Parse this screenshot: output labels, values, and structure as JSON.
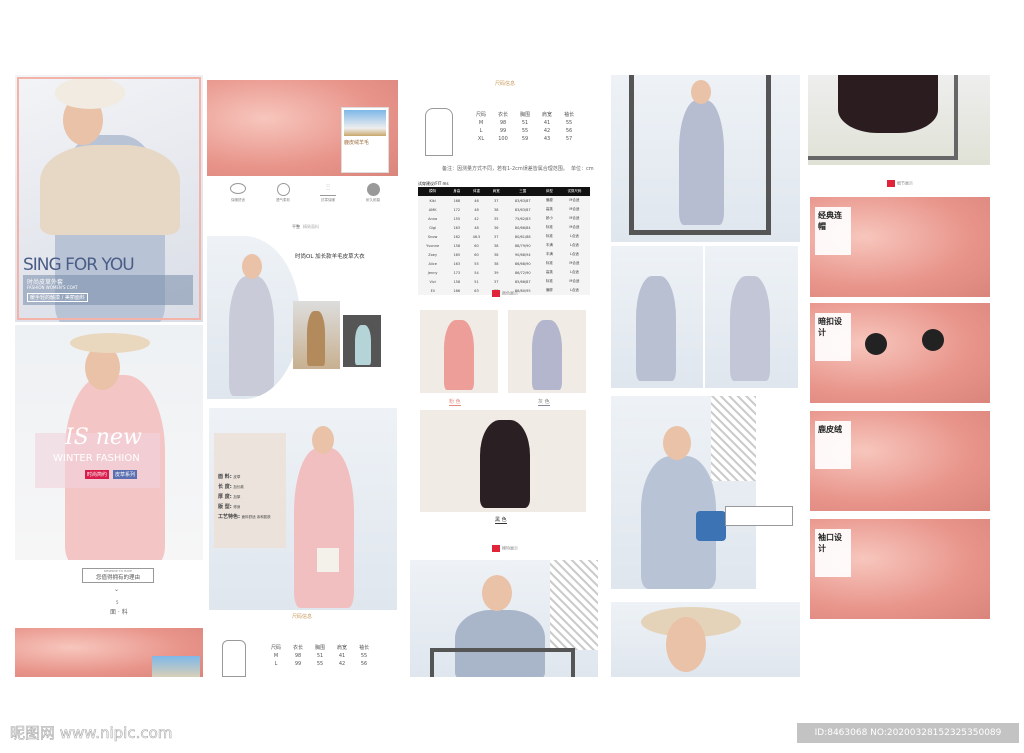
{
  "col1": {
    "banner_title": "SING FOR YOU",
    "banner_cn": "时尚皮草外套",
    "banner_en": "FASHION WOMEN'S COAT",
    "banner_sub": "暖手轻的触摸 / 美丽面料",
    "is_new": "IS new",
    "winter": "WINTER FASHION",
    "badge1": "时尚简约",
    "badge2": "皮草系列",
    "deserve_en": "DESERVE TO HAVE",
    "deserve_cn": "您值得拥有的理由",
    "section_no": "5",
    "section_title": "面 · 料"
  },
  "col2": {
    "fabric_title": "鹿皮绒羊毛",
    "features": [
      "保暖舒适",
      "透气柔软",
      "抗寒保暖",
      "耐久耐磨"
    ],
    "tabs": [
      "平整",
      "精致面料"
    ],
    "intro_title": "时尚OL 加长款羊毛皮草大衣",
    "details": [
      {
        "k": "面 料:",
        "v": "皮草"
      },
      {
        "k": "长 度:",
        "v": "加长款"
      },
      {
        "k": "厚 度:",
        "v": "加厚"
      },
      {
        "k": "版 型:",
        "v": "修身"
      },
      {
        "k": "工艺特色:",
        "v": "面料舒适 亲和肌肤"
      }
    ],
    "size_header": "尺码信息"
  },
  "sizes": {
    "headers": [
      "尺码",
      "衣长",
      "胸围",
      "肩宽",
      "袖长"
    ],
    "rows": [
      [
        "M",
        "98",
        "51",
        "41",
        "55"
      ],
      [
        "L",
        "99",
        "55",
        "42",
        "56"
      ],
      [
        "XL",
        "100",
        "59",
        "43",
        "57"
      ]
    ],
    "note": "备注：因测量方式不同，若有1-2cm误差皆属合理范围。",
    "unit": "单位：cm",
    "title": "尺码信息"
  },
  "tryon": {
    "title": "试穿建议/FIT ms",
    "headers": [
      "模特",
      "身高",
      "体重",
      "肩宽",
      "三围",
      "体型",
      "试穿尺码"
    ],
    "rows": [
      [
        "Kiki",
        "168",
        "46",
        "37",
        "83/63/87",
        "偏瘦",
        "M合适"
      ],
      [
        "AMK",
        "172",
        "48",
        "38",
        "83/63/87",
        "高挑",
        "M合适"
      ],
      [
        "Anna",
        "155",
        "42",
        "35",
        "75/62/83",
        "娇小",
        "M合适"
      ],
      [
        "Gigi",
        "163",
        "48",
        "36",
        "80/66/84",
        "标准",
        "M合适"
      ],
      [
        "Snow",
        "162",
        "46.5",
        "37",
        "80/61/88",
        "标准",
        "L合适"
      ],
      [
        "Yvonne",
        "158",
        "60",
        "38",
        "88/79/90",
        "丰满",
        "L合适"
      ],
      [
        "Zoey",
        "165",
        "60",
        "38",
        "90/68/94",
        "丰满",
        "L合适"
      ],
      [
        "Alice",
        "163",
        "55",
        "38",
        "86/68/90",
        "标准",
        "M合适"
      ],
      [
        "Jenny",
        "173",
        "54",
        "39",
        "86/72/90",
        "高挑",
        "L合适"
      ],
      [
        "Vivi",
        "158",
        "51",
        "37",
        "85/66/87",
        "标准",
        "M合适"
      ],
      [
        "Eli",
        "166",
        "63",
        "38",
        "86/80/95",
        "偏胖",
        "L合适"
      ]
    ]
  },
  "colors": {
    "header": "颜色展示",
    "pink": "粉 色",
    "grey": "灰 色",
    "black": "黑 色",
    "model_header": "模特展示"
  },
  "col5": {
    "header": "细节展示",
    "details": [
      "经典连帽",
      "暗扣设计",
      "鹿皮绒",
      "袖口设计"
    ]
  },
  "footer": {
    "site": "昵图网 www.nipic.com",
    "id": "ID:8463068 NO:20200328152325350089"
  },
  "accent": "#e0243a"
}
